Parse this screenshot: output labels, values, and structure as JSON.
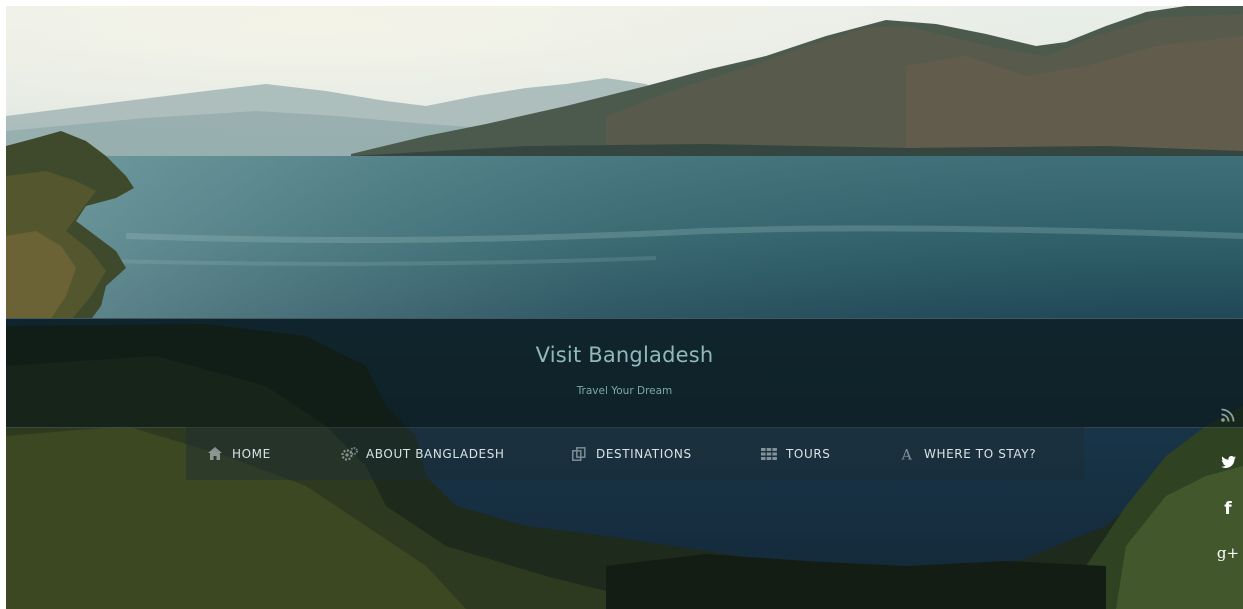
{
  "header": {
    "title": "Visit Bangladesh",
    "tagline": "Travel Your Dream"
  },
  "nav": {
    "items": [
      {
        "label": "HOME",
        "icon": "home-icon"
      },
      {
        "label": "ABOUT BANGLADESH",
        "icon": "gears-icon"
      },
      {
        "label": "DESTINATIONS",
        "icon": "copy-icon"
      },
      {
        "label": "TOURS",
        "icon": "grid-icon"
      },
      {
        "label": "WHERE TO STAY?",
        "icon": "font-icon"
      }
    ]
  },
  "social": {
    "icons": [
      "rss-icon",
      "twitter-icon",
      "facebook-icon",
      "google-plus-icon"
    ],
    "facebook_glyph": "f",
    "google_glyph": "g+"
  },
  "colors": {
    "title": "#8fb9bb",
    "nav_text": "#d9e3e6",
    "band": "#0a1616"
  }
}
